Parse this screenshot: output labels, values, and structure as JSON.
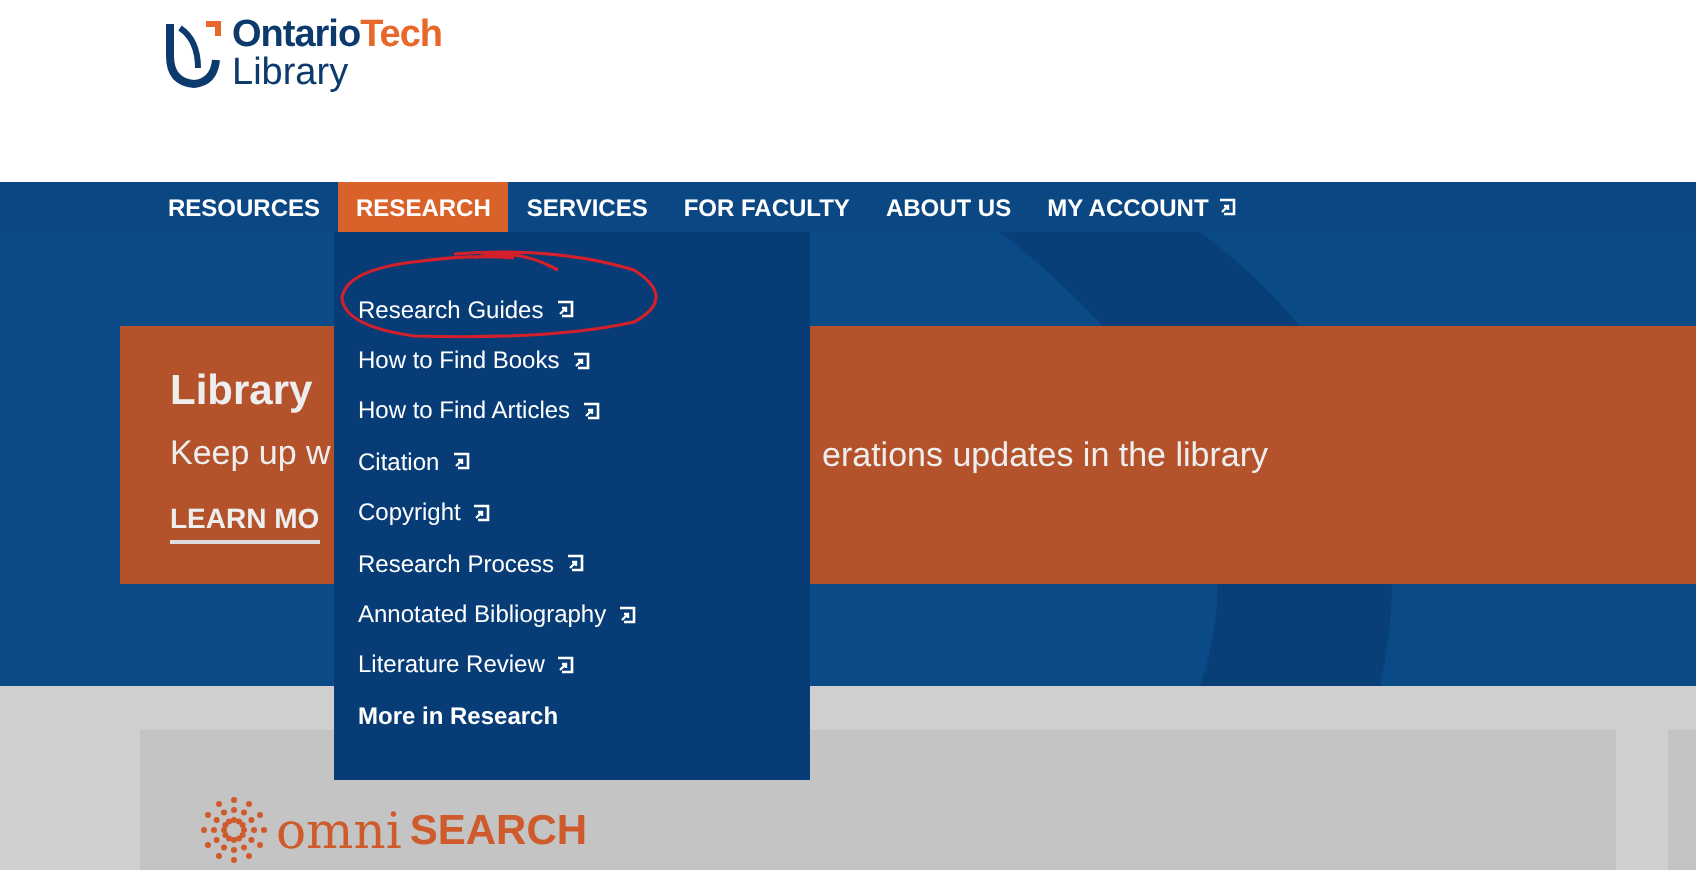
{
  "logo": {
    "word_1": "Ontario",
    "word_2": "Tech",
    "subtitle": "Library"
  },
  "nav": [
    {
      "label": "RESOURCES",
      "selected": false,
      "external": false
    },
    {
      "label": "RESEARCH",
      "selected": true,
      "external": false
    },
    {
      "label": "SERVICES",
      "selected": false,
      "external": false
    },
    {
      "label": "FOR FACULTY",
      "selected": false,
      "external": false
    },
    {
      "label": "ABOUT US",
      "selected": false,
      "external": false
    },
    {
      "label": "MY ACCOUNT",
      "selected": false,
      "external": true
    }
  ],
  "dropdown": {
    "items": [
      {
        "label": "Research Guides",
        "kind": "link",
        "external": true,
        "circled": true
      },
      {
        "label": "How to Find Books",
        "kind": "link",
        "external": true,
        "circled": false
      },
      {
        "label": "How to Find Articles",
        "kind": "link",
        "external": true,
        "circled": false
      },
      {
        "label": "Citation",
        "kind": "link",
        "external": true,
        "circled": false
      },
      {
        "label": "Copyright",
        "kind": "link",
        "external": true,
        "circled": false
      },
      {
        "label": "Research Process",
        "kind": "link",
        "external": true,
        "circled": false
      },
      {
        "label": "Annotated Bibliography",
        "kind": "link",
        "external": true,
        "circled": false
      },
      {
        "label": "Literature Review",
        "kind": "link",
        "external": true,
        "circled": false
      },
      {
        "label": "More in Research",
        "kind": "more",
        "external": false,
        "circled": false
      }
    ]
  },
  "banner": {
    "title": "Library",
    "text_left": "Keep up w",
    "text_right": "erations updates in the library",
    "link": "LEARN MO"
  },
  "search_card": {
    "word_1": "omni",
    "word_2": "SEARCH"
  }
}
